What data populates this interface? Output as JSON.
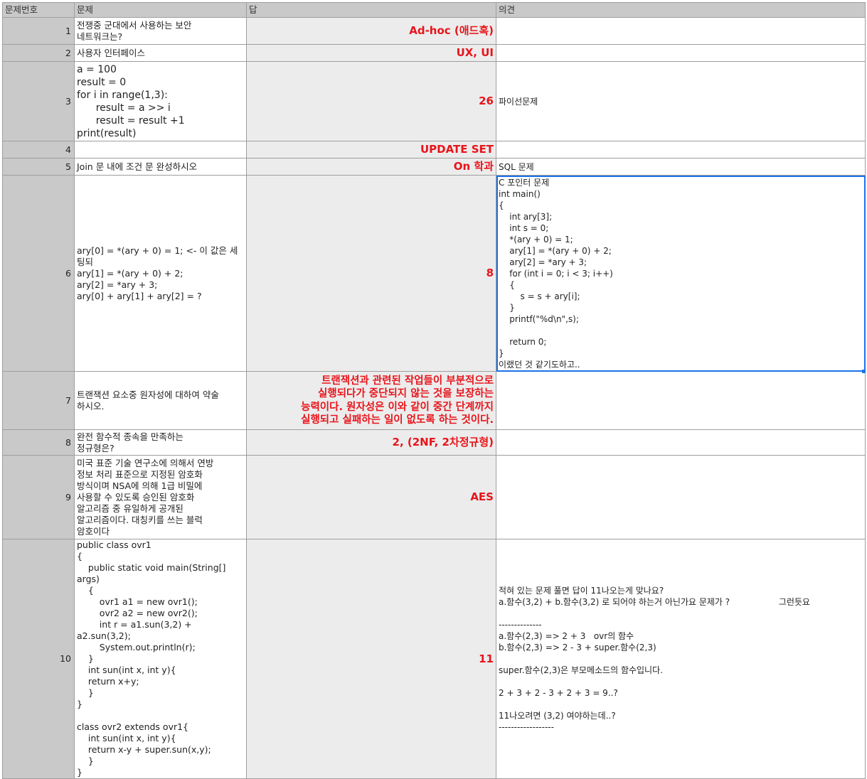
{
  "headers": [
    "문제번호",
    "문제",
    "답",
    "의견"
  ],
  "rows": [
    {
      "num": "1",
      "question": "전쟁중 군대에서 사용하는 보안\n네트워크는?",
      "answer": "Ad-hoc (애드혹)",
      "comment": ""
    },
    {
      "num": "2",
      "question": "사용자 인터페이스",
      "answer": "UX, UI",
      "comment": ""
    },
    {
      "num": "3",
      "question": "a = 100\nresult = 0\nfor i in range(1,3):\n      result = a >> i\n      result = result +1\nprint(result)",
      "answer": "26",
      "comment": "파이선문제"
    },
    {
      "num": "4",
      "question": "",
      "answer": "UPDATE SET",
      "comment": ""
    },
    {
      "num": "5",
      "question": "Join 문 내에 조건 문 완성하시오",
      "answer": "On 학과",
      "comment": "SQL 문제"
    },
    {
      "num": "6",
      "question": "ary[0] = *(ary + 0) = 1; <- 이 값은 세팅되\nary[1] = *(ary + 0) + 2;\nary[2] = *ary + 3;\nary[0] + ary[1] + ary[2] = ?",
      "answer": "8",
      "comment": "C 포인터 문제\nint main()\n{\n    int ary[3];\n    int s = 0;\n    *(ary + 0) = 1;\n    ary[1] = *(ary + 0) + 2;\n    ary[2] = *ary + 3;\n    for (int i = 0; i < 3; i++)\n    {\n        s = s + ary[i];\n    }\n    printf(\"%d\\n\",s);\n\n    return 0;\n}\n이랬던 것 같기도하고.."
    },
    {
      "num": "7",
      "question": "트랜잭션 요소중 원자성에 대하여 약술\n하시오.",
      "answer": "트랜잭션과 관련된 작업들이 부분적으로\n실행되다가 중단되지 않는 것을 보장하는\n능력이다. 원자성은 이와 같이 중간 단계까지\n실행되고 실패하는 일이 없도록 하는 것이다.",
      "comment": ""
    },
    {
      "num": "8",
      "question": "완전 함수적 종속을 만족하는\n정규형은?",
      "answer": "2, (2NF, 2차정규형)",
      "comment": ""
    },
    {
      "num": "9",
      "question": "미국 표준 기술 연구소에 의해서 연방\n정보 처리 표준으로 지정된 암호화\n방식이며 NSA에 의해 1급 비밀에\n사용할 수 있도록 승인된 암호화\n알고리즘 중 유일하게 공개된\n알고리즘이다. 대칭키를 쓰는 블럭\n암호이다",
      "answer": "AES",
      "comment": ""
    },
    {
      "num": "10",
      "question": "public class ovr1\n{\n    public static void main(String[] args)\n    {\n        ovr1 a1 = new ovr1();\n        ovr2 a2 = new ovr2();\n        int r = a1.sun(3,2) + a2.sun(3,2);\n        System.out.println(r);\n    }\n    int sun(int x, int y){\n    return x+y;\n    }\n}\n\nclass ovr2 extends ovr1{\n    int sun(int x, int y){\n    return x-y + super.sun(x,y);\n    }\n}",
      "answer": "11",
      "comment": "적혀 있는 문제 풀면 답이 11나오는게 맞나요?\na.함수(3,2) + b.함수(3,2) 로 되어야 하는거 아닌가요 문제가 ?                  그런듯요\n\n--------------\na.함수(2,3) => 2 + 3   ovr의 함수\nb.함수(2,3) => 2 - 3 + super.함수(2,3)\n\nsuper.함수(2,3)은 부모메소드의 함수입니다.\n\n2 + 3 + 2 - 3 + 2 + 3 = 9..?\n\n11나오려면 (3,2) 여야하는데..?\n------------------"
    }
  ]
}
